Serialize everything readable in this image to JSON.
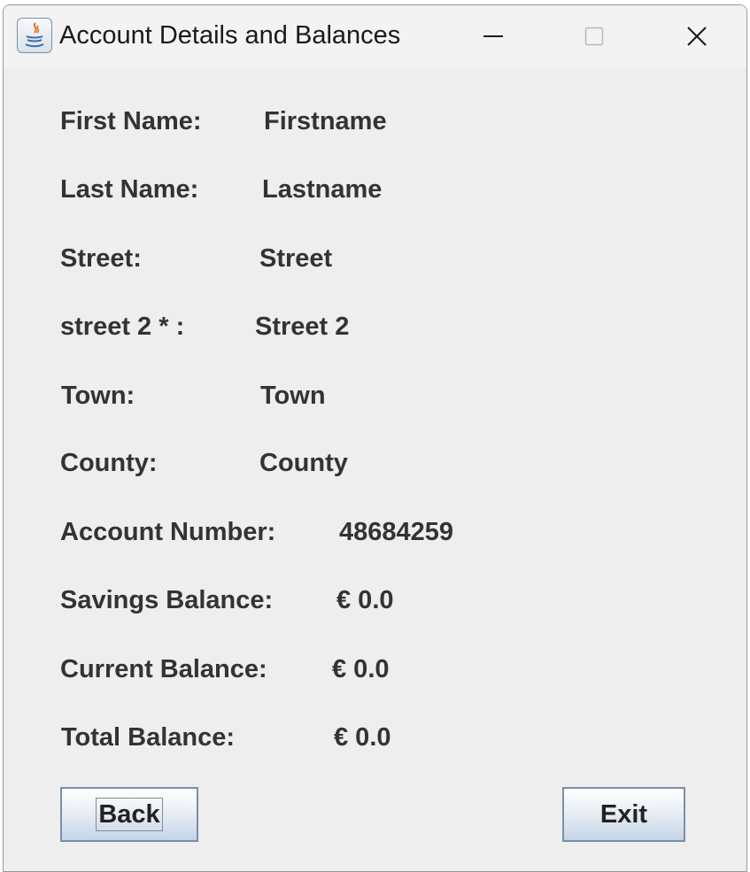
{
  "window": {
    "title": "Account Details and Balances",
    "controls": {
      "minimize": "minimize-icon",
      "maximize": "maximize-icon",
      "close": "close-icon"
    }
  },
  "fields": {
    "first_name": {
      "label": "First Name:",
      "value": "Firstname"
    },
    "last_name": {
      "label": "Last Name:",
      "value": "Lastname"
    },
    "street": {
      "label": "Street:",
      "value": "Street"
    },
    "street2": {
      "label": "street 2 * :",
      "value": "Street 2"
    },
    "town": {
      "label": "Town:",
      "value": "Town"
    },
    "county": {
      "label": "County:",
      "value": "County"
    },
    "account_number": {
      "label": "Account Number:",
      "value": "48684259"
    },
    "savings_balance": {
      "label": "Savings Balance:",
      "value": "€ 0.0"
    },
    "current_balance": {
      "label": "Current Balance:",
      "value": "€ 0.0"
    },
    "total_balance": {
      "label": "Total Balance:",
      "value": "€ 0.0"
    }
  },
  "buttons": {
    "back": "Back",
    "exit": "Exit"
  },
  "colors": {
    "panel": "#eeeeee",
    "titlebar": "#f3f3f3",
    "text": "#333333"
  }
}
